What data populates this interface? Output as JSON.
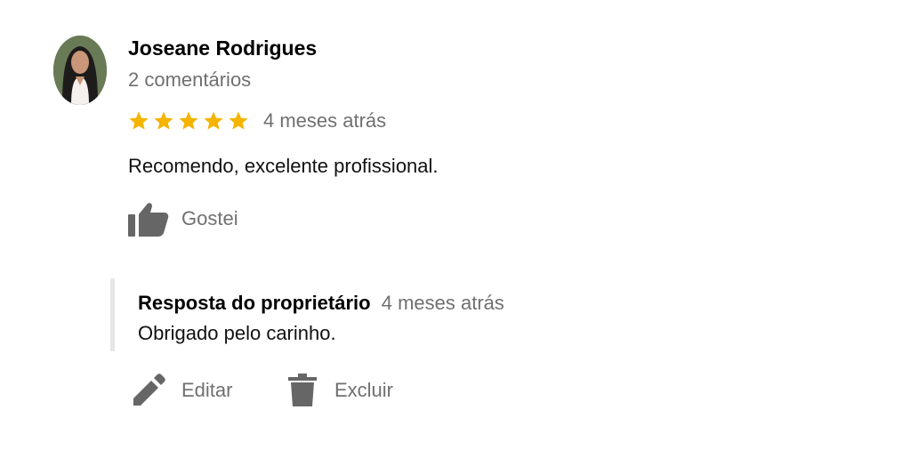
{
  "review": {
    "author": "Joseane Rodrigues",
    "author_meta": "2 comentários",
    "rating": 5,
    "max_rating": 5,
    "time": "4 meses atrás",
    "text": "Recomendo, excelente profissional.",
    "like_label": "Gostei",
    "star_color": "#F4B400"
  },
  "reply": {
    "title": "Resposta do proprietário",
    "time": "4 meses atrás",
    "text": "Obrigado pelo carinho."
  },
  "actions": {
    "edit_label": "Editar",
    "delete_label": "Excluir"
  },
  "icons": {
    "like": "thumbs-up-icon",
    "edit": "pencil-icon",
    "delete": "trash-icon"
  }
}
